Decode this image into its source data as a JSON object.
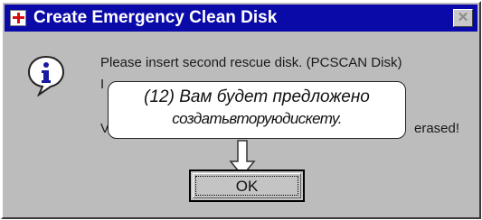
{
  "window": {
    "title": "Create Emergency Clean Disk",
    "close_symbol": "✕"
  },
  "icons": {
    "app": "red-cross-icon",
    "message": "info-icon",
    "pointer": "down-arrow-icon"
  },
  "message": {
    "line1": "Please insert second rescue disk. (PCSCAN Disk)",
    "line1_cont": "I",
    "line2_start": "V",
    "line2_end": "erased!"
  },
  "callout": {
    "line1": "(12) Вам будет предложено",
    "line2": "создатьвторуюдискету."
  },
  "buttons": {
    "ok_label": "OK"
  },
  "colors": {
    "title_bar": "#0a0aa8",
    "dialog_face": "#bcbcbc",
    "info_blue": "#1a1aa0"
  }
}
